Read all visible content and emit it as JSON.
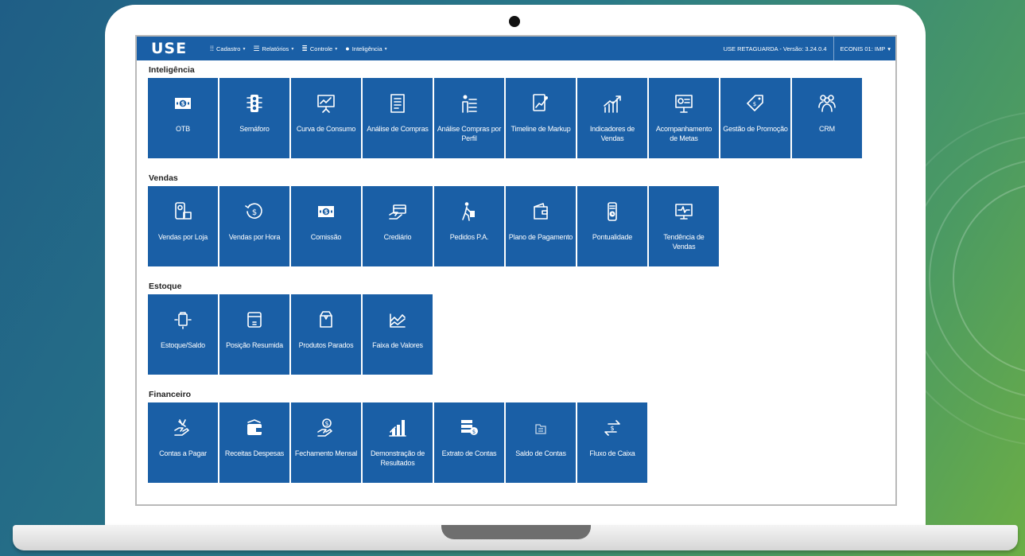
{
  "header": {
    "logo": "USE",
    "menu": [
      {
        "label": "Cadastro",
        "icon": "grid-icon"
      },
      {
        "label": "Relatórios",
        "icon": "report-icon"
      },
      {
        "label": "Controle",
        "icon": "list-icon"
      },
      {
        "label": "Inteligência",
        "icon": "lightbulb-icon"
      }
    ],
    "version": "USE RETAGUARDA - Versão: 3.24.0.4",
    "user": "ECONIS 01: IMP"
  },
  "sections": [
    {
      "title": "Inteligência",
      "tiles": [
        {
          "label": "OTB",
          "icon": "money-icon"
        },
        {
          "label": "Semáforo",
          "icon": "traffic-light-icon"
        },
        {
          "label": "Curva de Consumo",
          "icon": "presentation-chart-icon"
        },
        {
          "label": "Análise de Compras",
          "icon": "document-icon"
        },
        {
          "label": "Análise Compras por Perfil",
          "icon": "profile-list-icon"
        },
        {
          "label": "Timeline de Markup",
          "icon": "timeline-icon"
        },
        {
          "label": "Indicadores de Vendas",
          "icon": "bar-growth-icon"
        },
        {
          "label": "Acompanhamento de Metas",
          "icon": "board-icon"
        },
        {
          "label": "Gestão de Promoção",
          "icon": "price-tag-icon"
        },
        {
          "label": "CRM",
          "icon": "people-icon"
        }
      ]
    },
    {
      "title": "Vendas",
      "tiles": [
        {
          "label": "Vendas por Loja",
          "icon": "store-sales-icon"
        },
        {
          "label": "Vendas por Hora",
          "icon": "clock-money-icon"
        },
        {
          "label": "Comissão",
          "icon": "money-icon"
        },
        {
          "label": "Crediário",
          "icon": "card-hand-icon"
        },
        {
          "label": "Pedidos P.A.",
          "icon": "walking-bag-icon"
        },
        {
          "label": "Plano de Pagamento",
          "icon": "wallet-icon"
        },
        {
          "label": "Pontualidade",
          "icon": "phone-clock-icon"
        },
        {
          "label": "Tendência de Vendas",
          "icon": "monitor-pulse-icon"
        }
      ]
    },
    {
      "title": "Estoque",
      "tiles": [
        {
          "label": "Estoque/Saldo",
          "icon": "box-arrows-icon"
        },
        {
          "label": "Posição Resumida",
          "icon": "box-icon"
        },
        {
          "label": "Produtos Parados",
          "icon": "package-icon"
        },
        {
          "label": "Faixa de Valores",
          "icon": "chart-frame-icon"
        }
      ]
    },
    {
      "title": "Financeiro",
      "tiles": [
        {
          "label": "Contas a Pagar",
          "icon": "hand-money-icon"
        },
        {
          "label": "Receitas Despesas",
          "icon": "wallet-cash-icon"
        },
        {
          "label": "Fechamento Mensal",
          "icon": "hand-coin-icon"
        },
        {
          "label": "Demonstração de Resultados",
          "icon": "bar-chart-icon"
        },
        {
          "label": "Extrato de Contas",
          "icon": "statement-icon"
        },
        {
          "label": "Saldo de Contas",
          "icon": "folder-icon"
        },
        {
          "label": "Fluxo de Caixa",
          "icon": "exchange-icon"
        }
      ]
    }
  ]
}
